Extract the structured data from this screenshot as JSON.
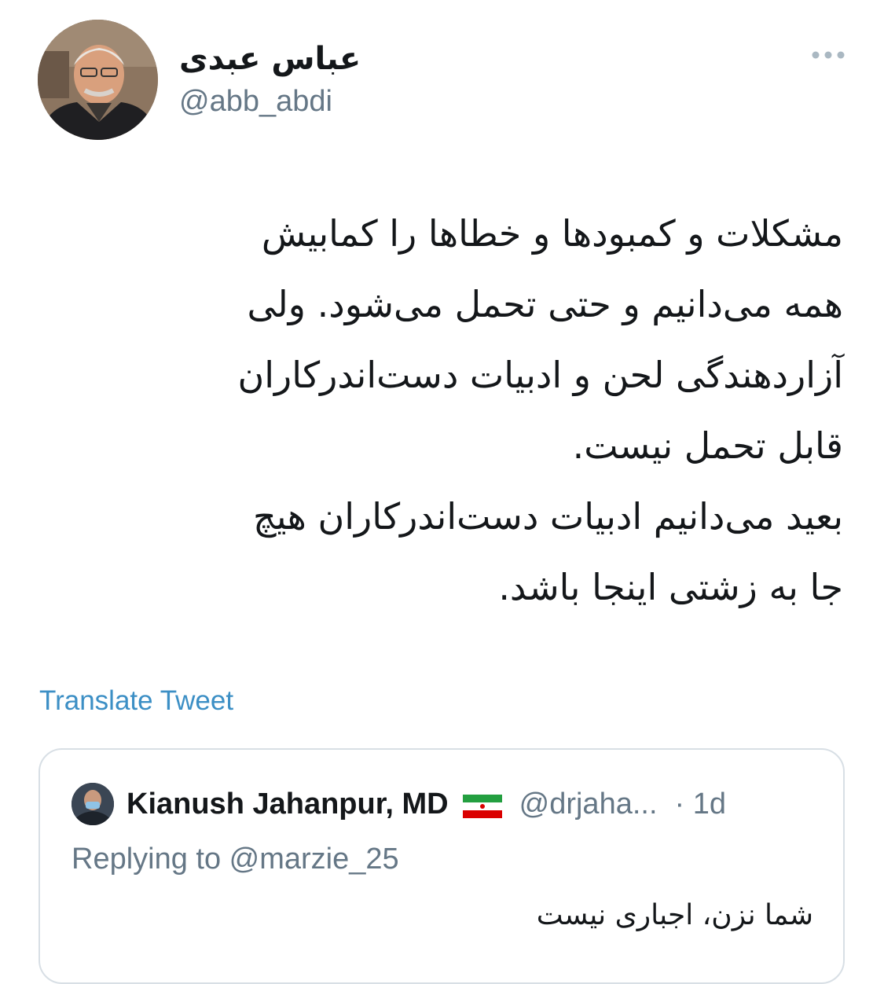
{
  "author": {
    "display_name": "عباس عبدی",
    "handle": "@abb_abdi",
    "avatar_icon": "profile-photo"
  },
  "menu": {
    "more_icon": "more-horizontal-icon",
    "dot_color": "#aab8c2"
  },
  "tweet": {
    "lines": [
      "مشکلات و کمبودها و خطاها را کمابیش",
      "همه می‌دانیم و حتی تحمل می‌شود. ولی",
      "آزاردهندگی لحن و ادبیات دست‌اندرکاران",
      "قابل تحمل نیست.",
      "بعید می‌دانیم ادبیات دست‌اندرکاران هیچ",
      "جا به زشتی اینجا باشد."
    ]
  },
  "translate_link": "Translate Tweet",
  "quoted_tweet": {
    "name": "Kianush Jahanpur, MD",
    "flag_icon": "iran-flag-icon",
    "handle": "@drjaha...",
    "time": "· 1d",
    "replying_to": "Replying to @marzie_25",
    "text": "شما نزن، اجباری نیست"
  },
  "colors": {
    "link": "#3c8fc5",
    "secondary_text": "#657786",
    "border": "#d8dfe5"
  }
}
